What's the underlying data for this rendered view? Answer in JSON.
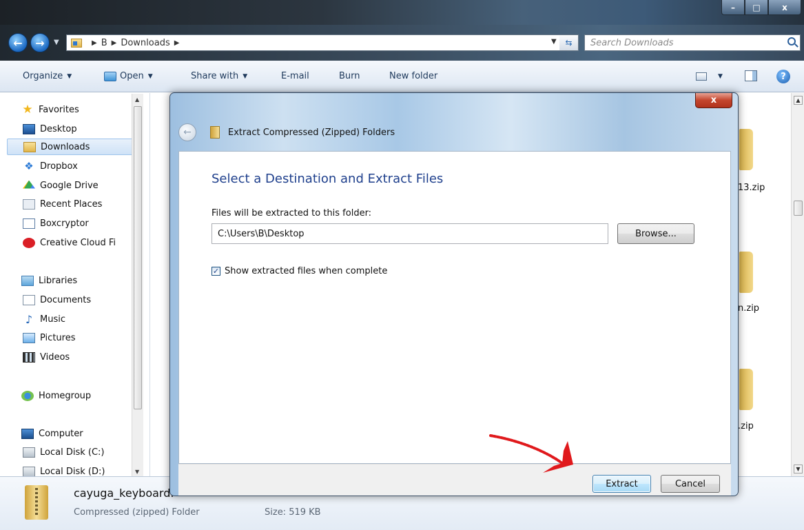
{
  "explorer": {
    "window_controls": {
      "minimize": "–",
      "maximize": "□",
      "close": "x"
    },
    "breadcrumb": [
      "B",
      "Downloads"
    ],
    "search_placeholder": "Search Downloads",
    "toolbar": {
      "organize": "Organize",
      "open": "Open",
      "share_with": "Share with",
      "email": "E-mail",
      "burn": "Burn",
      "new_folder": "New folder"
    },
    "nav": {
      "favorites_label": "Favorites",
      "favorites": [
        "Desktop",
        "Downloads",
        "Dropbox",
        "Google Drive",
        "Recent Places",
        "Boxcryptor",
        "Creative Cloud Fi"
      ],
      "selected": "Downloads",
      "libraries_label": "Libraries",
      "libraries": [
        "Documents",
        "Music",
        "Pictures",
        "Videos"
      ],
      "homegroup": "Homegroup",
      "computer_label": "Computer",
      "drives": [
        "Local Disk (C:)",
        "Local Disk (D:)"
      ]
    },
    "files_partial": [
      "13.zip",
      "n.zip",
      ".zip"
    ],
    "details": {
      "name": "cayuga_keyboard.",
      "type": "Compressed (zipped) Folder",
      "size": "Size: 519 KB"
    }
  },
  "dialog": {
    "title": "Extract Compressed (Zipped) Folders",
    "close_label": "x",
    "heading": "Select a Destination and Extract Files",
    "folder_label": "Files will be extracted to this folder:",
    "path_value": "C:\\Users\\B\\Desktop",
    "browse_label": "Browse...",
    "show_files_label": "Show extracted files when complete",
    "show_files_checked": true,
    "extract_label": "Extract",
    "cancel_label": "Cancel",
    "annotation_color": "#e0191c"
  }
}
